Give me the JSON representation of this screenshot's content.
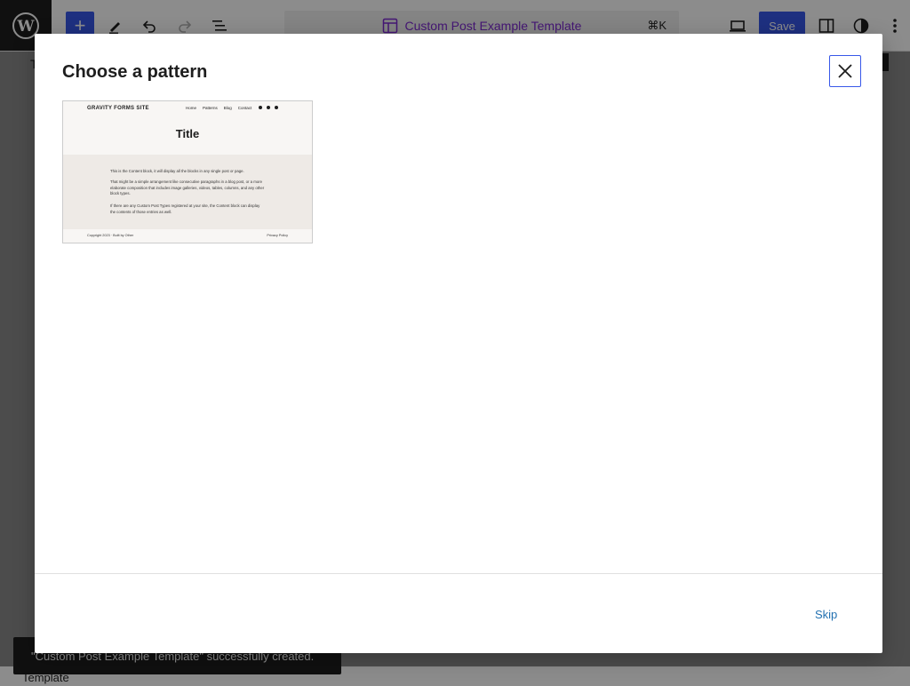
{
  "toolbar": {
    "document_title": "Custom Post Example Template",
    "command_shortcut": "⌘K",
    "save_label": "Save",
    "inserter_symbol": "+"
  },
  "background": {
    "letter": "T",
    "snackbar_message": "\"Custom Post Example Template\" successfully created.",
    "footer_label": "Template"
  },
  "modal": {
    "title": "Choose a pattern",
    "skip_label": "Skip",
    "pattern_preview": {
      "site_title": "GRAVITY FORMS SITE",
      "nav": [
        "Home",
        "Patterns",
        "Blog",
        "Contact"
      ],
      "title": "Title",
      "paragraphs": [
        "This is the Content block, it will display all the blocks in any single post or page.",
        "That might be a simple arrangement like consecutive paragraphs in a blog post, or a more elaborate composition that includes image galleries, videos, tables, columns, and any other block types.",
        "If there are any Custom Post Types registered at your site, the Content block can display the contents of those entries as well."
      ],
      "copyright": "Copyright 2023 · Built by Other",
      "privacy": "Privacy Policy"
    }
  },
  "colors": {
    "accent": "#3858e9",
    "template_purple": "#7f2ad4",
    "link": "#2271b1",
    "dark": "#1e1e1e"
  },
  "icons": [
    "wordpress-logo-icon",
    "pencil-icon",
    "undo-icon",
    "redo-icon",
    "list-view-icon",
    "template-icon",
    "desktop-preview-icon",
    "settings-sidebar-icon",
    "styles-icon",
    "options-icon",
    "close-icon"
  ]
}
